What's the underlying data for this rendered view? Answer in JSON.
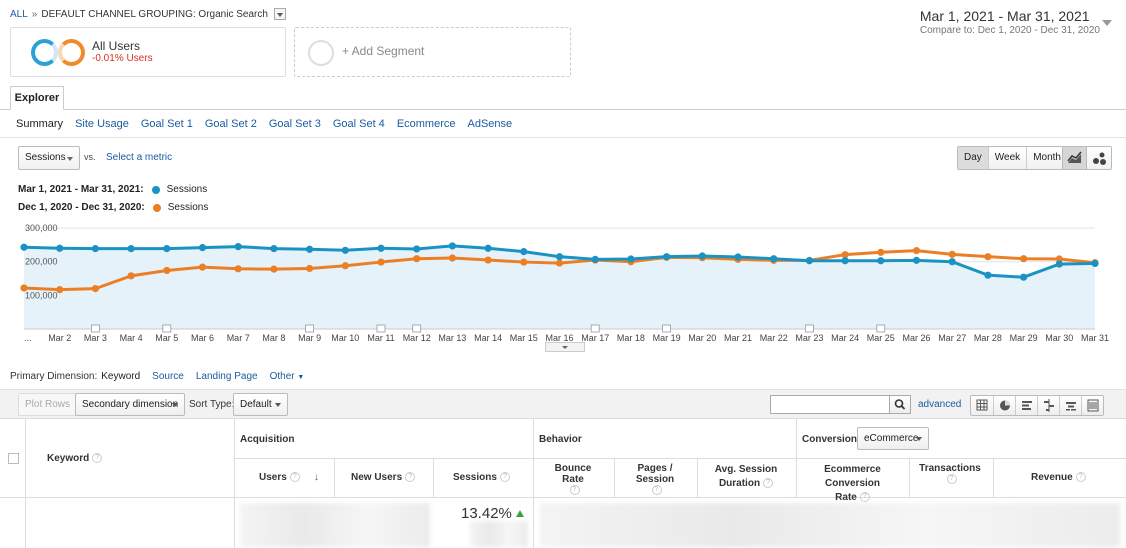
{
  "breadcrumb": {
    "all_label": "ALL",
    "separator": "»",
    "grouping_label": "DEFAULT CHANNEL GROUPING: Organic Search"
  },
  "date_range": {
    "main": "Mar 1, 2021 - Mar 31, 2021",
    "compare": "Compare to: Dec 1, 2020 - Dec 31, 2020"
  },
  "segments": {
    "all_users_label": "All Users",
    "all_users_change": "-0.01% Users",
    "add_label": "+ Add Segment"
  },
  "tabs": {
    "explorer": "Explorer"
  },
  "subtabs": [
    "Summary",
    "Site Usage",
    "Goal Set 1",
    "Goal Set 2",
    "Goal Set 3",
    "Goal Set 4",
    "Ecommerce",
    "AdSense"
  ],
  "metric": {
    "selected": "Sessions",
    "vs_label": "vs.",
    "select_metric": "Select a metric"
  },
  "period_buttons": [
    "Day",
    "Week",
    "Month"
  ],
  "legend": {
    "current_range": "Mar 1, 2021 - Mar 31, 2021:",
    "compare_range": "Dec 1, 2020 - Dec 31, 2020:",
    "series_label": "Sessions"
  },
  "colors": {
    "current": "#1a93c4",
    "compare": "#ec7f25",
    "fill": "#e6f2f9",
    "link": "#1a5c9e"
  },
  "chart_data": {
    "type": "line",
    "x_ticks": [
      "...",
      "Mar 2",
      "Mar 3",
      "Mar 4",
      "Mar 5",
      "Mar 6",
      "Mar 7",
      "Mar 8",
      "Mar 9",
      "Mar 10",
      "Mar 11",
      "Mar 12",
      "Mar 13",
      "Mar 14",
      "Mar 15",
      "Mar 16",
      "Mar 17",
      "Mar 18",
      "Mar 19",
      "Mar 20",
      "Mar 21",
      "Mar 22",
      "Mar 23",
      "Mar 24",
      "Mar 25",
      "Mar 26",
      "Mar 27",
      "Mar 28",
      "Mar 29",
      "Mar 30",
      "Mar 31"
    ],
    "y_ticks": [
      "300,000",
      "200,000",
      "100,000"
    ],
    "ylim": [
      0,
      330000
    ],
    "annotation_days": [
      3,
      5,
      9,
      11,
      12,
      17,
      19,
      23,
      25
    ],
    "series": [
      {
        "name": "Sessions",
        "values": [
          243000,
          240000,
          239000,
          239000,
          239000,
          242000,
          245000,
          239000,
          237000,
          234000,
          240000,
          238000,
          247000,
          240000,
          230000,
          215000,
          207000,
          208000,
          215000,
          217000,
          214000,
          209000,
          203000,
          203000,
          203000,
          204000,
          200000,
          160000,
          154000,
          193000,
          195000
        ]
      },
      {
        "name": "Sessions",
        "values": [
          122000,
          117000,
          120000,
          158000,
          174000,
          184000,
          179000,
          178000,
          180000,
          188000,
          199000,
          209000,
          211000,
          205000,
          199000,
          196000,
          205000,
          200000,
          213000,
          212000,
          207000,
          204000,
          204000,
          221000,
          228000,
          233000,
          222000,
          215000,
          209000,
          208000,
          197000
        ]
      }
    ]
  },
  "primary_dimension": {
    "label": "Primary Dimension:",
    "active": "Keyword",
    "options": [
      "Source",
      "Landing Page"
    ],
    "other": "Other"
  },
  "toolbar": {
    "plot_rows": "Plot Rows",
    "secondary_dimension": "Secondary dimension",
    "sort_label": "Sort Type:",
    "sort_value": "Default",
    "search_value": "",
    "advanced": "advanced"
  },
  "table": {
    "keyword_header": "Keyword",
    "groups": {
      "acquisition": "Acquisition",
      "behavior": "Behavior",
      "conversions": "Conversions"
    },
    "conversions_select": "eCommerce",
    "columns": {
      "users": "Users",
      "new_users": "New Users",
      "sessions": "Sessions",
      "bounce_rate": "Bounce Rate",
      "pages_session": "Pages / Session",
      "avg_session_1": "Avg. Session",
      "avg_session_2": "Duration",
      "ecom_conv_1": "Ecommerce Conversion",
      "ecom_conv_2": "Rate",
      "transactions": "Transactions",
      "revenue": "Revenue"
    },
    "sessions_change": "13.42%"
  }
}
